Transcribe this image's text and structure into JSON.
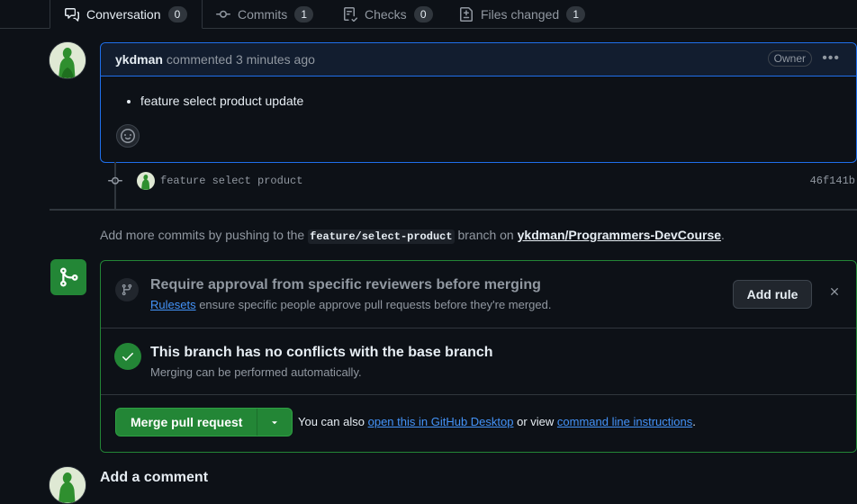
{
  "tabs": [
    {
      "label": "Conversation",
      "count": "0",
      "icon": "comment-discussion-icon"
    },
    {
      "label": "Commits",
      "count": "1",
      "icon": "git-commit-icon"
    },
    {
      "label": "Checks",
      "count": "0",
      "icon": "checklist-icon"
    },
    {
      "label": "Files changed",
      "count": "1",
      "icon": "file-diff-icon"
    }
  ],
  "comment": {
    "author": "ykdman",
    "meta": "commented 3 minutes ago",
    "badge": "Owner",
    "body_item": "feature select product update"
  },
  "commit": {
    "message": "feature select product",
    "sha": "46f141b"
  },
  "push_note": {
    "prefix": "Add more commits by pushing to the",
    "branch": "feature/select-product",
    "middle": "branch on",
    "repo": "ykdman/Programmers-DevCourse",
    "suffix": "."
  },
  "merge": {
    "rule_title": "Require approval from specific reviewers before merging",
    "rule_link": "Rulesets",
    "rule_desc": "ensure specific people approve pull requests before they're merged.",
    "add_rule": "Add rule",
    "no_conflict_title": "This branch has no conflicts with the base branch",
    "no_conflict_desc": "Merging can be performed automatically.",
    "merge_button": "Merge pull request",
    "alt_prefix": "You can also",
    "alt_link1": "open this in GitHub Desktop",
    "alt_middle": "or view",
    "alt_link2": "command line instructions",
    "alt_suffix": "."
  },
  "add_comment": {
    "title": "Add a comment"
  },
  "colors": {
    "background": "#0d1117",
    "accent_green": "#238636",
    "accent_blue": "#1f6feb",
    "link": "#4493f8"
  }
}
